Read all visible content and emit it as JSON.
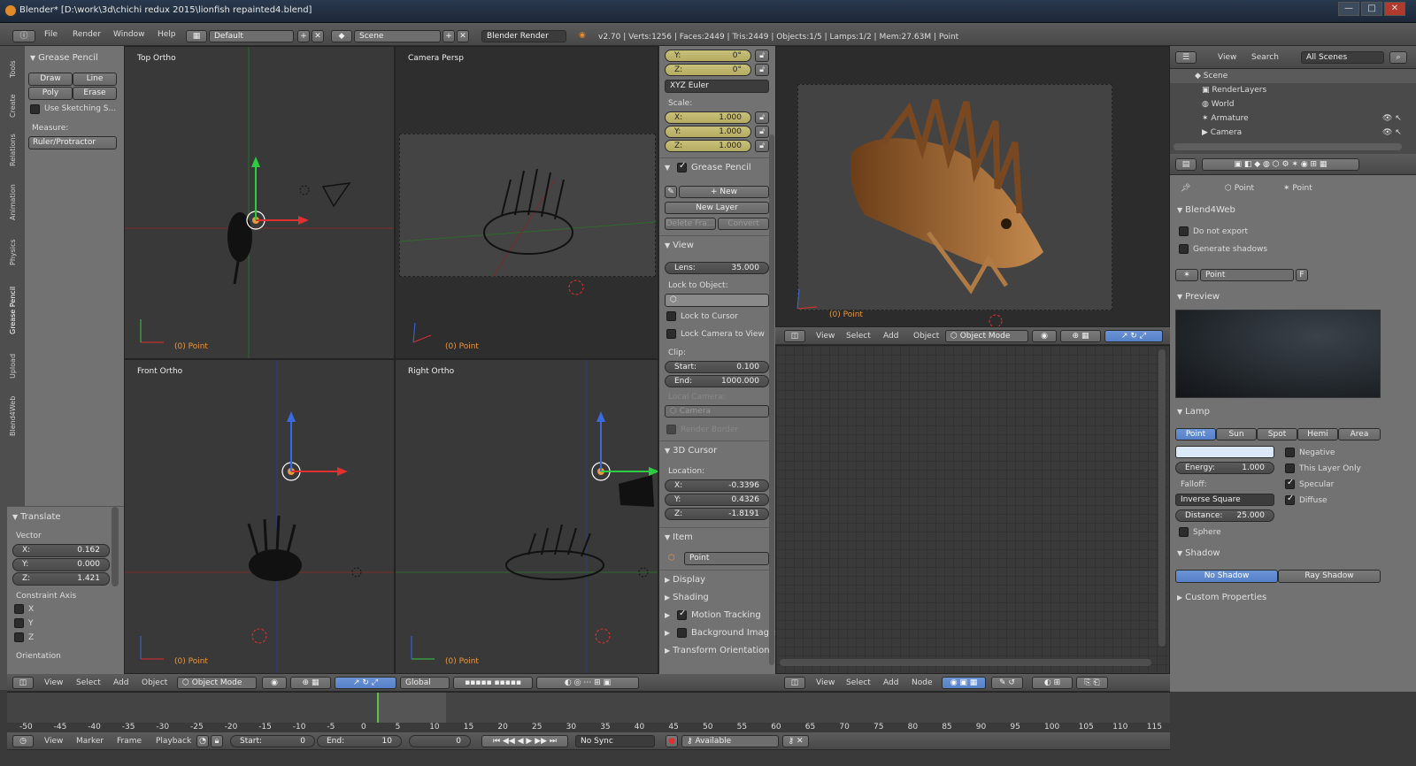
{
  "window": {
    "title": "Blender* [D:\\work\\3d\\chichi redux 2015\\lionfish repainted4.blend]",
    "controls": [
      "—",
      "□",
      "✕"
    ]
  },
  "info_header": {
    "menus": [
      "File",
      "Render",
      "Window",
      "Help"
    ],
    "screen": "Default",
    "scene": "Scene",
    "engine": "Blender Render",
    "stats": "v2.70 | Verts:1256 | Faces:2449 | Tris:2449 | Objects:1/5 | Lamps:1/2 | Mem:27.63M | Point"
  },
  "tool_shelf": {
    "tabs": [
      "Tools",
      "Create",
      "Relations",
      "Animation",
      "Physics",
      "Grease Pencil",
      "Upload",
      "Blend4Web"
    ],
    "grease_pencil_title": "Grease Pencil",
    "draw": "Draw",
    "line": "Line",
    "poly": "Poly",
    "erase": "Erase",
    "use_sketching": "Use Sketching S...",
    "measure_label": "Measure:",
    "ruler": "Ruler/Protractor"
  },
  "operator_panel": {
    "title": "Translate",
    "vector_label": "Vector",
    "x": {
      "label": "X:",
      "value": "0.162"
    },
    "y": {
      "label": "Y:",
      "value": "0.000"
    },
    "z": {
      "label": "Z:",
      "value": "1.421"
    },
    "constraint_label": "Constraint Axis",
    "axes": [
      "X",
      "Y",
      "Z"
    ],
    "orientation": "Orientation"
  },
  "viewports": {
    "top": {
      "name": "Top Ortho",
      "obj": "(0) Point"
    },
    "camera": {
      "name": "Camera Persp",
      "obj": "(0) Point"
    },
    "front": {
      "name": "Front Ortho",
      "obj": "(0) Point"
    },
    "right": {
      "name": "Right Ortho",
      "obj": "(0) Point"
    }
  },
  "properties_region": {
    "rot_y": {
      "label": "Y:",
      "value": "0°"
    },
    "rot_z": {
      "label": "Z:",
      "value": "0°"
    },
    "rot_mode": "XYZ Euler",
    "scale_label": "Scale:",
    "scale_x": {
      "label": "X:",
      "value": "1.000"
    },
    "scale_y": {
      "label": "Y:",
      "value": "1.000"
    },
    "scale_z": {
      "label": "Z:",
      "value": "1.000"
    },
    "gp_title": "Grease Pencil",
    "new": "New",
    "new_layer": "New Layer",
    "delete_frame": "Delete Fra...",
    "convert": "Convert",
    "view_title": "View",
    "lens": {
      "label": "Lens:",
      "value": "35.000"
    },
    "lock_to_object": "Lock to Object:",
    "lock_to_cursor": "Lock to Cursor",
    "lock_camera": "Lock Camera to View",
    "clip_label": "Clip:",
    "clip_start": {
      "label": "Start:",
      "value": "0.100"
    },
    "clip_end": {
      "label": "End:",
      "value": "1000.000"
    },
    "local_camera": "Local Camera:",
    "camera": "Camera",
    "render_border": "Render Border",
    "cursor_title": "3D Cursor",
    "location_label": "Location:",
    "loc_x": {
      "label": "X:",
      "value": "-0.3396"
    },
    "loc_y": {
      "label": "Y:",
      "value": "0.4326"
    },
    "loc_z": {
      "label": "Z:",
      "value": "-1.8191"
    },
    "item_title": "Item",
    "item_name": "Point",
    "display": "Display",
    "shading": "Shading",
    "motion_tracking": "Motion Tracking",
    "background_images": "Background Images",
    "transform_orientations": "Transform Orientations"
  },
  "view3d_header": {
    "menus": [
      "View",
      "Select",
      "Add",
      "Object"
    ],
    "mode": "Object Mode",
    "orientation": "Global"
  },
  "render_viewport": {
    "obj": "(0) Point",
    "menus": [
      "View",
      "Select",
      "Add",
      "Object"
    ],
    "mode": "Object Mode"
  },
  "node_editor": {
    "menus": [
      "View",
      "Select",
      "Add",
      "Node"
    ]
  },
  "outliner": {
    "menus": [
      "View",
      "Search"
    ],
    "filter": "All Scenes",
    "items": [
      "Scene",
      "RenderLayers",
      "World",
      "Armature",
      "Camera"
    ]
  },
  "properties_editor": {
    "breadcrumb1": "Point",
    "breadcrumb2": "Point",
    "b4w_title": "Blend4Web",
    "do_not_export": "Do not export",
    "generate_shadows": "Generate shadows",
    "lamp_name": "Point",
    "f_label": "F",
    "preview_title": "Preview",
    "lamp_title": "Lamp",
    "lamp_types": [
      "Point",
      "Sun",
      "Spot",
      "Hemi",
      "Area"
    ],
    "negative": "Negative",
    "energy": {
      "label": "Energy:",
      "value": "1.000"
    },
    "this_layer_only": "This Layer Only",
    "falloff_label": "Falloff:",
    "specular": "Specular",
    "falloff": "Inverse Square",
    "diffuse": "Diffuse",
    "distance": {
      "label": "Distance:",
      "value": "25.000"
    },
    "sphere": "Sphere",
    "shadow_title": "Shadow",
    "no_shadow": "No Shadow",
    "ray_shadow": "Ray Shadow",
    "custom_properties": "Custom Properties",
    "lamp_color": "#dbe8f7"
  },
  "timeline": {
    "ticks": [
      "-50",
      "-45",
      "-40",
      "-35",
      "-30",
      "-25",
      "-20",
      "-15",
      "-10",
      "-5",
      "0",
      "5",
      "10",
      "15",
      "20",
      "25",
      "30",
      "35",
      "40",
      "45",
      "50",
      "55",
      "60",
      "65",
      "70",
      "75",
      "80",
      "85",
      "90",
      "95",
      "100",
      "105",
      "110",
      "115"
    ],
    "menus": [
      "View",
      "Marker",
      "Frame",
      "Playback"
    ],
    "start": {
      "label": "Start:",
      "value": "0"
    },
    "end": {
      "label": "End:",
      "value": "10"
    },
    "current": "0",
    "sync": "No Sync",
    "keying": "Available"
  }
}
